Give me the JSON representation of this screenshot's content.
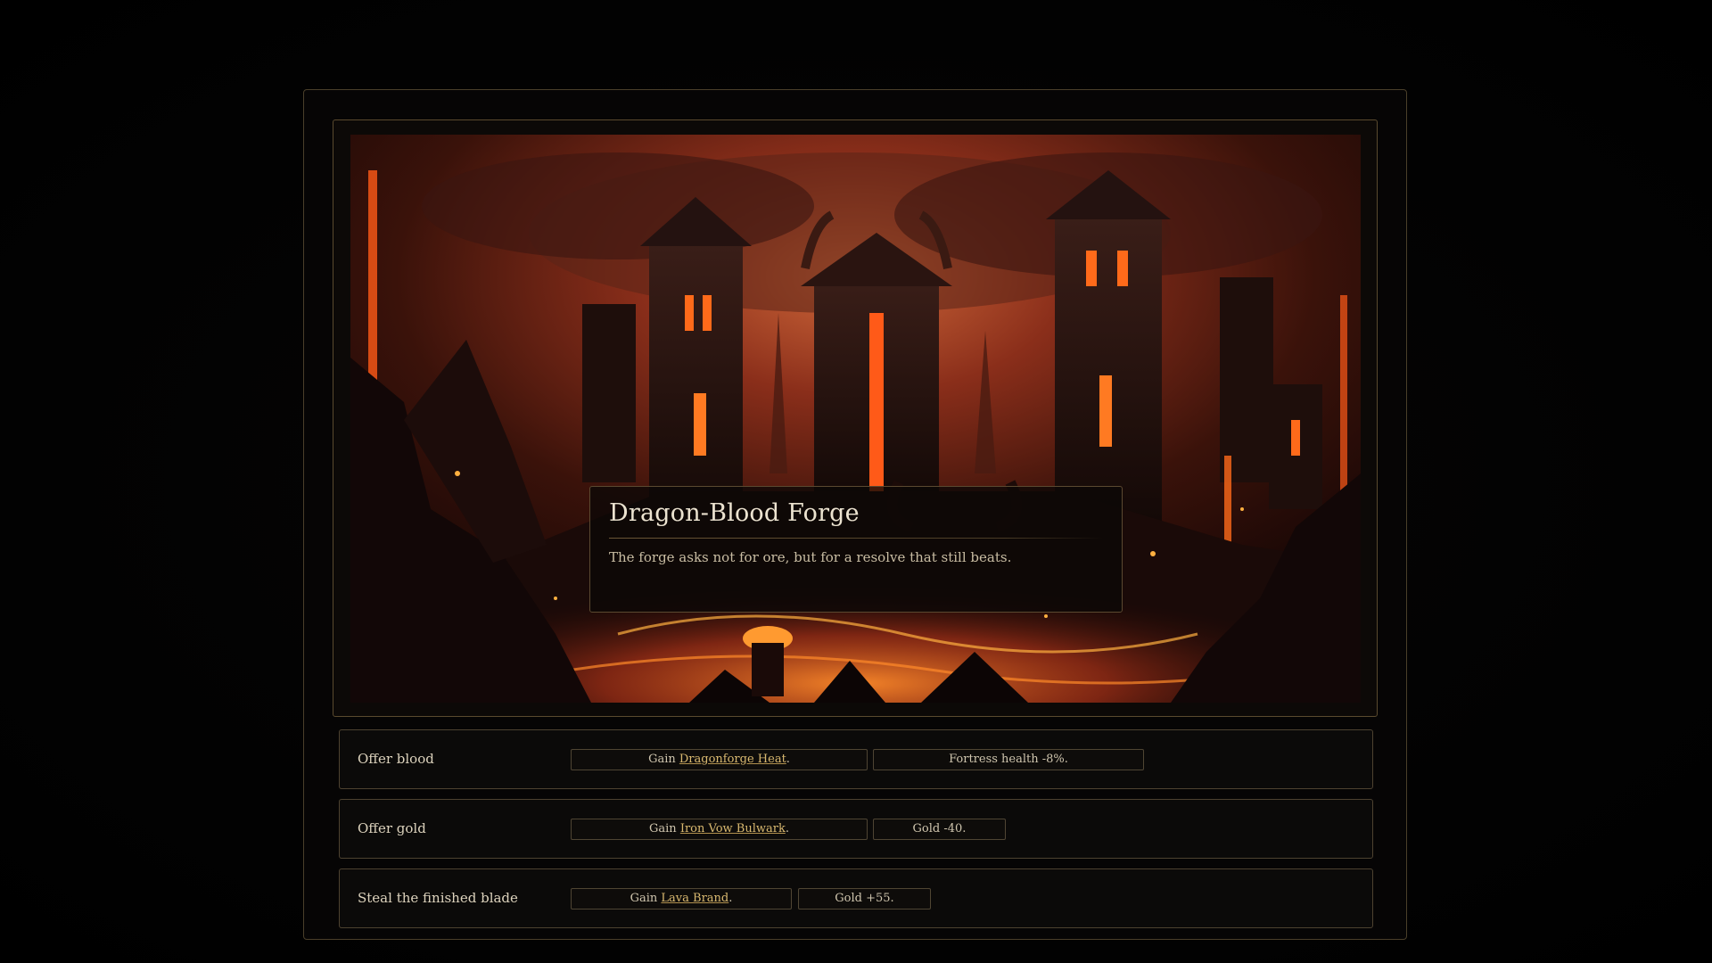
{
  "event": {
    "title": "Dragon-Blood Forge",
    "description": "The forge asks not for ore, but for a resolve that still beats."
  },
  "scene": {
    "image_name": "volcanic-fortress-forge-illustration",
    "colors": {
      "sky": "#a8452a",
      "lava": "#ff6a1a",
      "rock": "#1a0d0a",
      "glow": "#ffb040"
    }
  },
  "choices": [
    {
      "label": "Offer blood",
      "effects": [
        {
          "prefix": "Gain ",
          "link": "Dragonforge Heat",
          "suffix": "."
        },
        {
          "text": "Fortress health -8%."
        }
      ]
    },
    {
      "label": "Offer gold",
      "effects": [
        {
          "prefix": "Gain ",
          "link": "Iron Vow Bulwark",
          "suffix": "."
        },
        {
          "text": "Gold -40."
        }
      ]
    },
    {
      "label": "Steal the finished blade",
      "effects": [
        {
          "prefix": "Gain ",
          "link": "Lava Brand",
          "suffix": "."
        },
        {
          "text": "Gold +55."
        }
      ]
    }
  ],
  "theme": {
    "border": "#4d4230",
    "accent_link": "#d9b970",
    "background": "#030303"
  }
}
